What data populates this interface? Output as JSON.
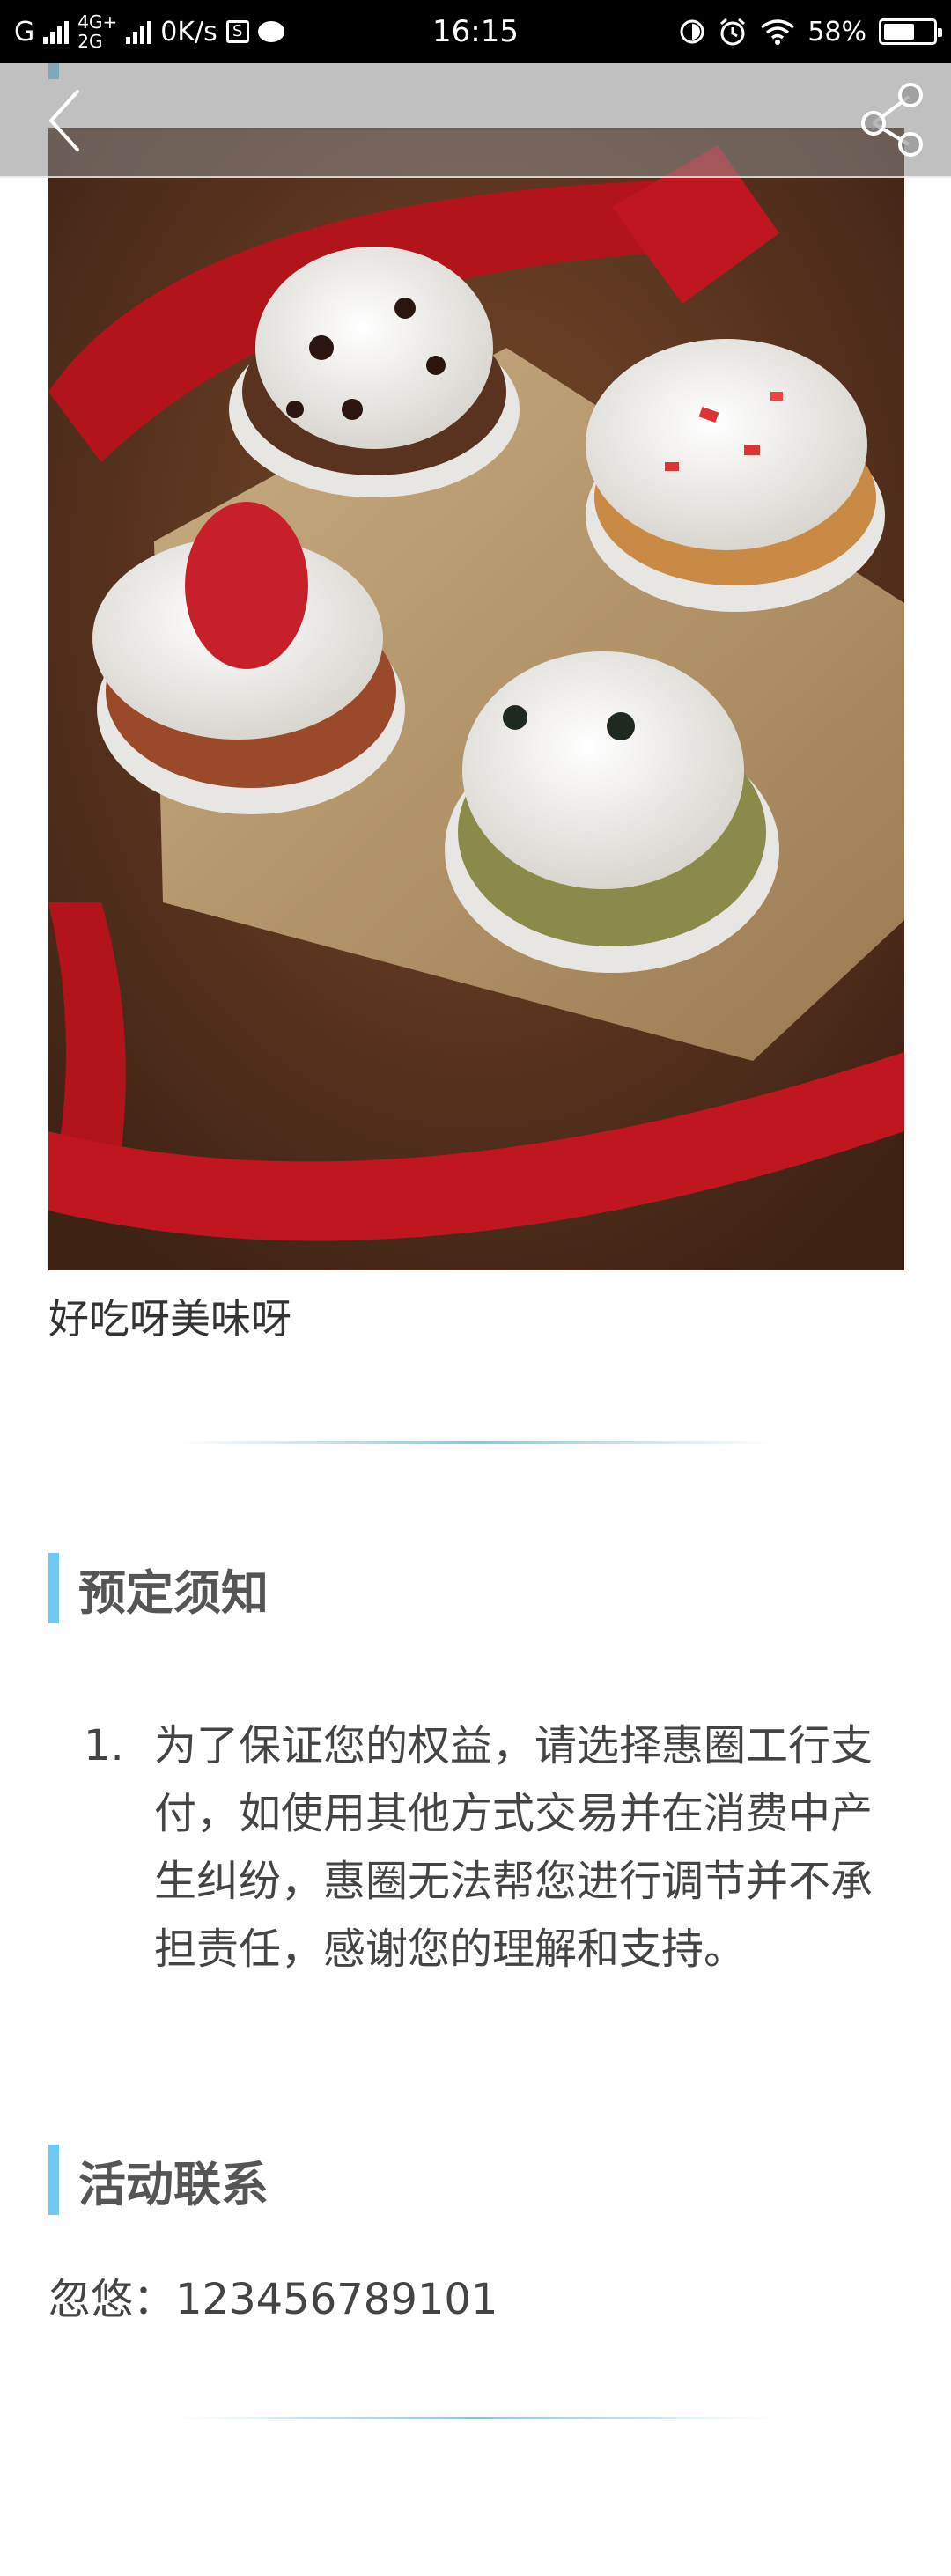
{
  "status_bar": {
    "carrier_left": "G",
    "network_top": "4G+",
    "network_bottom": "2G",
    "speed": "0K/s",
    "time": "16:15",
    "battery": "58%"
  },
  "icons": {
    "back": "chevron-left-icon",
    "share": "share-icon"
  },
  "content": {
    "caption": "好吃呀美味呀",
    "notice_section": {
      "title": "预定须知",
      "items": [
        {
          "number": "1.",
          "text": "为了保证您的权益，请选择惠圈工行支付，如使用其他方式交易并在消费中产生纠纷，惠圈无法帮您进行调节并不承担责任，感谢您的理解和支持。"
        }
      ]
    },
    "contact_section": {
      "title": "活动联系",
      "contact": "忽悠：123456789101"
    }
  },
  "colors": {
    "accent_bar": "#6fcaf3",
    "divider": "#7cc9ef",
    "status_bar_bg": "#000000"
  }
}
